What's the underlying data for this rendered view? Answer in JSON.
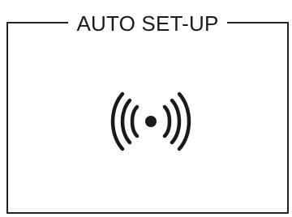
{
  "screen": {
    "title": "AUTO SET-UP",
    "icon": "broadcast-signal-icon",
    "colors": {
      "background": "#ffffff",
      "foreground": "#1a1a1a"
    }
  }
}
